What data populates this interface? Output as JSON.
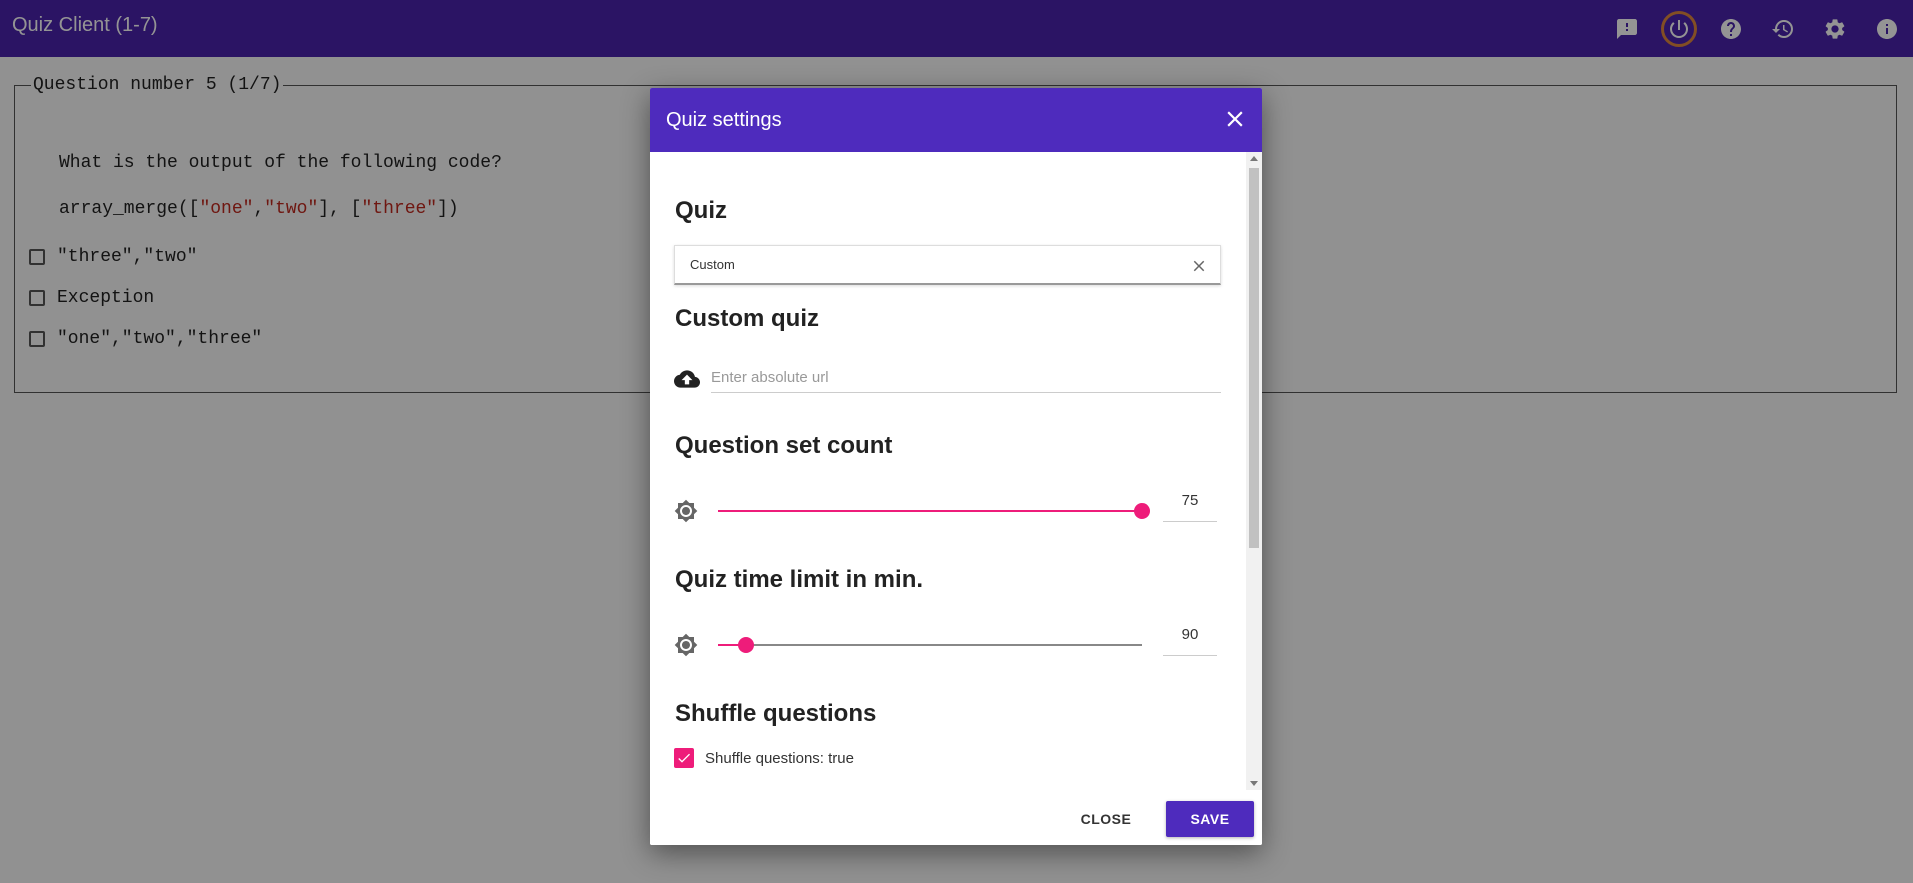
{
  "app": {
    "title": "Quiz Client (1-7)"
  },
  "toolbar": {
    "icons": [
      "feedback-icon",
      "power-icon",
      "help-icon",
      "history-icon",
      "settings-icon",
      "info-icon"
    ],
    "accent": "#4a23ad",
    "highlight_ring": "#e0873f"
  },
  "question": {
    "legend": "Question number 5 (1/7)",
    "text": "What is the output of the following code?",
    "code_prefix": "array_merge([",
    "code_s1": "\"one\"",
    "code_comma": ",",
    "code_s2": "\"two\"",
    "code_mid": "], [",
    "code_s3": "\"three\"",
    "code_suffix": "])",
    "options": [
      {
        "label": "\"three\",\"two\"",
        "checked": false
      },
      {
        "label": "Exception",
        "checked": false
      },
      {
        "label": "\"one\",\"two\",\"three\"",
        "checked": false
      }
    ]
  },
  "dialog": {
    "title": "Quiz settings",
    "quiz_heading": "Quiz",
    "quiz_value": "Custom",
    "custom_heading": "Custom quiz",
    "url_placeholder": "Enter absolute url",
    "count_heading": "Question set count",
    "count_value": "75",
    "count_fraction": 1.0,
    "time_heading": "Quiz time limit in min.",
    "time_value": "90",
    "time_fraction": 0.065,
    "shuffle_heading": "Shuffle questions",
    "shuffle_label": "Shuffle questions: true",
    "shuffle_checked": true,
    "close_label": "CLOSE",
    "save_label": "SAVE",
    "slider_color": "#ee1c7a"
  }
}
